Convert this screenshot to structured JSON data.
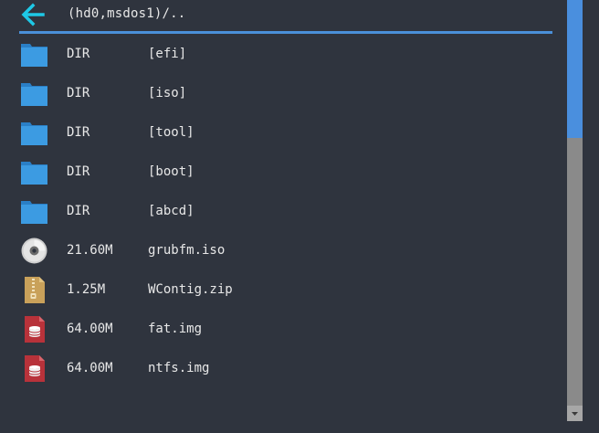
{
  "header": {
    "path": "(hd0,msdos1)/..",
    "back_icon": "arrow-left-icon",
    "accent_color": "#4a90d9",
    "back_color": "#1ec8e6"
  },
  "files": [
    {
      "size": "DIR",
      "name": "[efi]",
      "icon": "folder-icon"
    },
    {
      "size": "DIR",
      "name": "[iso]",
      "icon": "folder-icon"
    },
    {
      "size": "DIR",
      "name": "[tool]",
      "icon": "folder-icon"
    },
    {
      "size": "DIR",
      "name": "[boot]",
      "icon": "folder-icon"
    },
    {
      "size": "DIR",
      "name": "[abcd]",
      "icon": "folder-icon"
    },
    {
      "size": "21.60M",
      "name": "grubfm.iso",
      "icon": "disc-icon"
    },
    {
      "size": "1.25M",
      "name": "WContig.zip",
      "icon": "zip-archive-icon"
    },
    {
      "size": "64.00M",
      "name": "fat.img",
      "icon": "disk-image-icon"
    },
    {
      "size": "64.00M",
      "name": "ntfs.img",
      "icon": "disk-image-icon"
    }
  ],
  "scrollbar": {
    "position_fraction": 0.0,
    "visible_fraction": 0.34,
    "thumb_color": "#4a8fde"
  }
}
